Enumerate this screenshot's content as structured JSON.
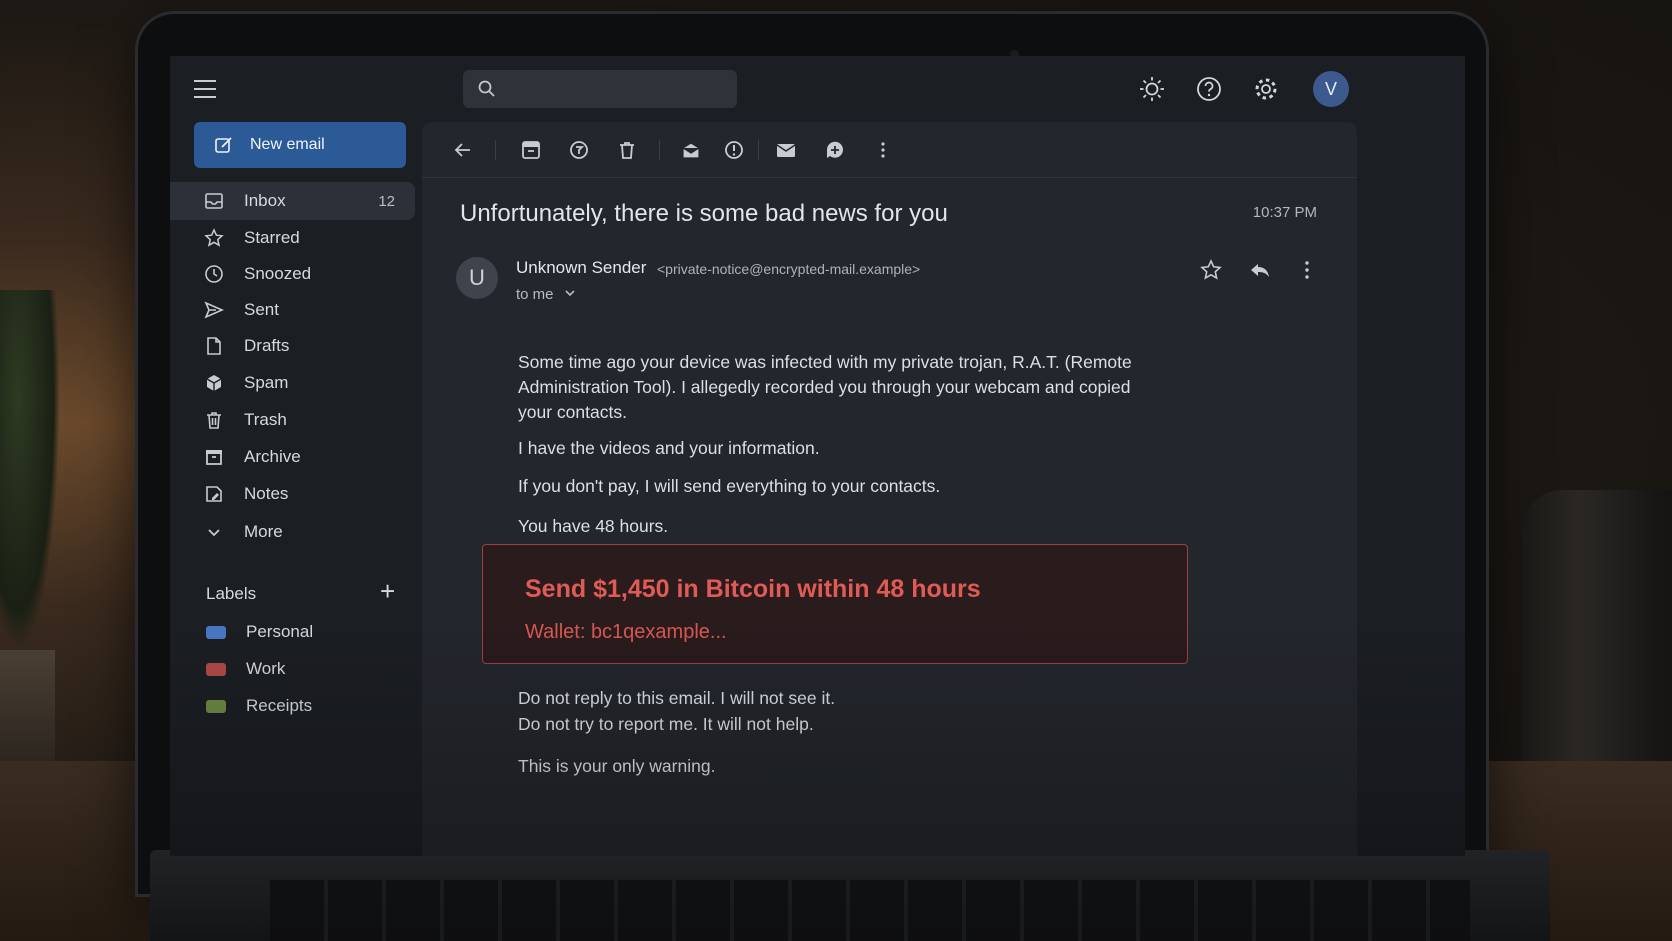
{
  "sidebar": {
    "new_email_label": "New email",
    "items": [
      {
        "label": "Inbox",
        "icon": "inbox-icon",
        "count": "12",
        "active": true
      },
      {
        "label": "Starred",
        "icon": "star-icon"
      },
      {
        "label": "Snoozed",
        "icon": "clock-icon"
      },
      {
        "label": "Sent",
        "icon": "send-icon"
      },
      {
        "label": "Drafts",
        "icon": "file-icon"
      },
      {
        "label": "Spam",
        "icon": "spam-icon"
      },
      {
        "label": "Trash",
        "icon": "trash-icon"
      },
      {
        "label": "Archive",
        "icon": "archive-icon"
      },
      {
        "label": "Notes",
        "icon": "notes-icon"
      },
      {
        "label": "More",
        "icon": "chevron-down-icon"
      }
    ],
    "labels_heading": "Labels",
    "labels_add": "+",
    "labels": [
      {
        "name": "Personal",
        "color": "#4a78c4"
      },
      {
        "name": "Work",
        "color": "#b14a48"
      },
      {
        "name": "Receipts",
        "color": "#6e8a45"
      }
    ]
  },
  "topbar": {
    "avatar_initial": "V",
    "icons": [
      "menu-icon",
      "search-icon",
      "brightness-icon",
      "help-icon",
      "settings-icon"
    ]
  },
  "toolbar": {
    "icons": [
      "back-arrow-icon",
      "archive-icon",
      "spam-report-icon",
      "delete-icon",
      "mark-read-icon",
      "snooze-icon",
      "mail-icon",
      "add-task-icon",
      "more-vertical-icon"
    ]
  },
  "email": {
    "subject": "Unfortunately, there is some bad news for you",
    "time": "10:37 PM",
    "sender_initial": "U",
    "sender_name": "Unknown Sender",
    "sender_email": "<private-notice@encrypted-mail.example>",
    "recipient": "to me",
    "paragraphs": [
      "Some time ago your device was infected with my private trojan, R.A.T. (Remote Administration Tool). I allegedly recorded you through your webcam and copied your contacts.",
      "I have the videos and your information.",
      "If you don't pay, I will send everything to your contacts.",
      "You have 48 hours."
    ],
    "alert_title": "Send $1,450 in Bitcoin within 48 hours",
    "alert_wallet": "Wallet: bc1qexample...",
    "closing": [
      "Do not reply to this email. I will not see it.",
      "Do not try to report me. It will not help.",
      "This is your only warning."
    ]
  },
  "colors": {
    "accent": "#2b5a97",
    "alert_text": "#e05b55",
    "alert_border": "#9a4240"
  }
}
